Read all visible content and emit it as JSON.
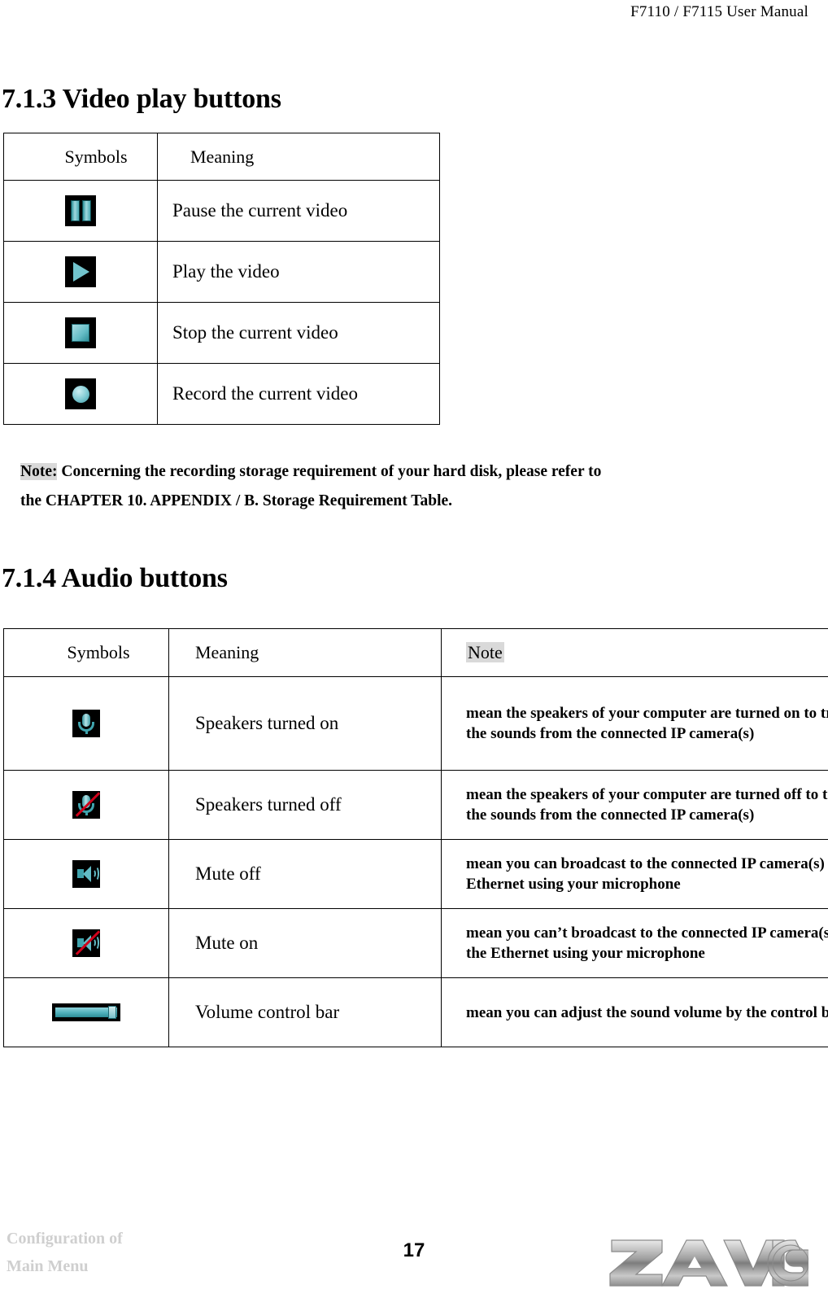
{
  "header": {
    "running_title": "F7110 / F7115 User Manual"
  },
  "sections": {
    "video": {
      "heading": "7.1.3 Video play buttons",
      "table": {
        "columns": [
          "Symbols",
          "Meaning"
        ],
        "rows": [
          {
            "icon": "pause-icon",
            "meaning": "Pause the current video"
          },
          {
            "icon": "play-icon",
            "meaning": "Play the video"
          },
          {
            "icon": "stop-icon",
            "meaning": "Stop the current video"
          },
          {
            "icon": "record-icon",
            "meaning": "Record the current video"
          }
        ]
      },
      "note": {
        "label": "Note:",
        "line1": "Concerning the recording storage requirement of your hard disk, please refer to",
        "line2": "the CHAPTER 10. APPENDIX / B. Storage Requirement Table."
      }
    },
    "audio": {
      "heading": "7.1.4 Audio buttons",
      "table": {
        "columns": [
          "Symbols",
          "Meaning",
          "Note"
        ],
        "rows": [
          {
            "icon": "microphone-on-icon",
            "meaning": "Speakers turned on",
            "note": "mean the speakers of your computer are turned on to transmit the sounds from the connected IP camera(s)"
          },
          {
            "icon": "microphone-off-icon",
            "meaning": "Speakers turned off",
            "note": "mean the speakers of your computer are turned off to transmit the sounds from the connected IP camera(s)"
          },
          {
            "icon": "speaker-on-icon",
            "meaning": "Mute off",
            "note": "mean you can broadcast to the connected IP camera(s) via the Ethernet using your microphone"
          },
          {
            "icon": "speaker-muted-icon",
            "meaning": "Mute on",
            "note": "mean you can’t broadcast to the connected IP camera(s) via the Ethernet using your microphone"
          },
          {
            "icon": "volume-control-bar-icon",
            "meaning": "Volume control bar",
            "note": "mean you can adjust the sound volume by the control bar"
          }
        ]
      }
    }
  },
  "footer": {
    "breadcrumb_line1": "Configuration of",
    "breadcrumb_line2": "Main Menu",
    "page_number": "17",
    "brand": "ZAVIO"
  },
  "colors": {
    "icon_accent": "#63bcc6",
    "icon_background": "#000000",
    "highlight": "#d9d9d9",
    "footer_text": "#cfcfcf",
    "slash": "#d0021b"
  }
}
